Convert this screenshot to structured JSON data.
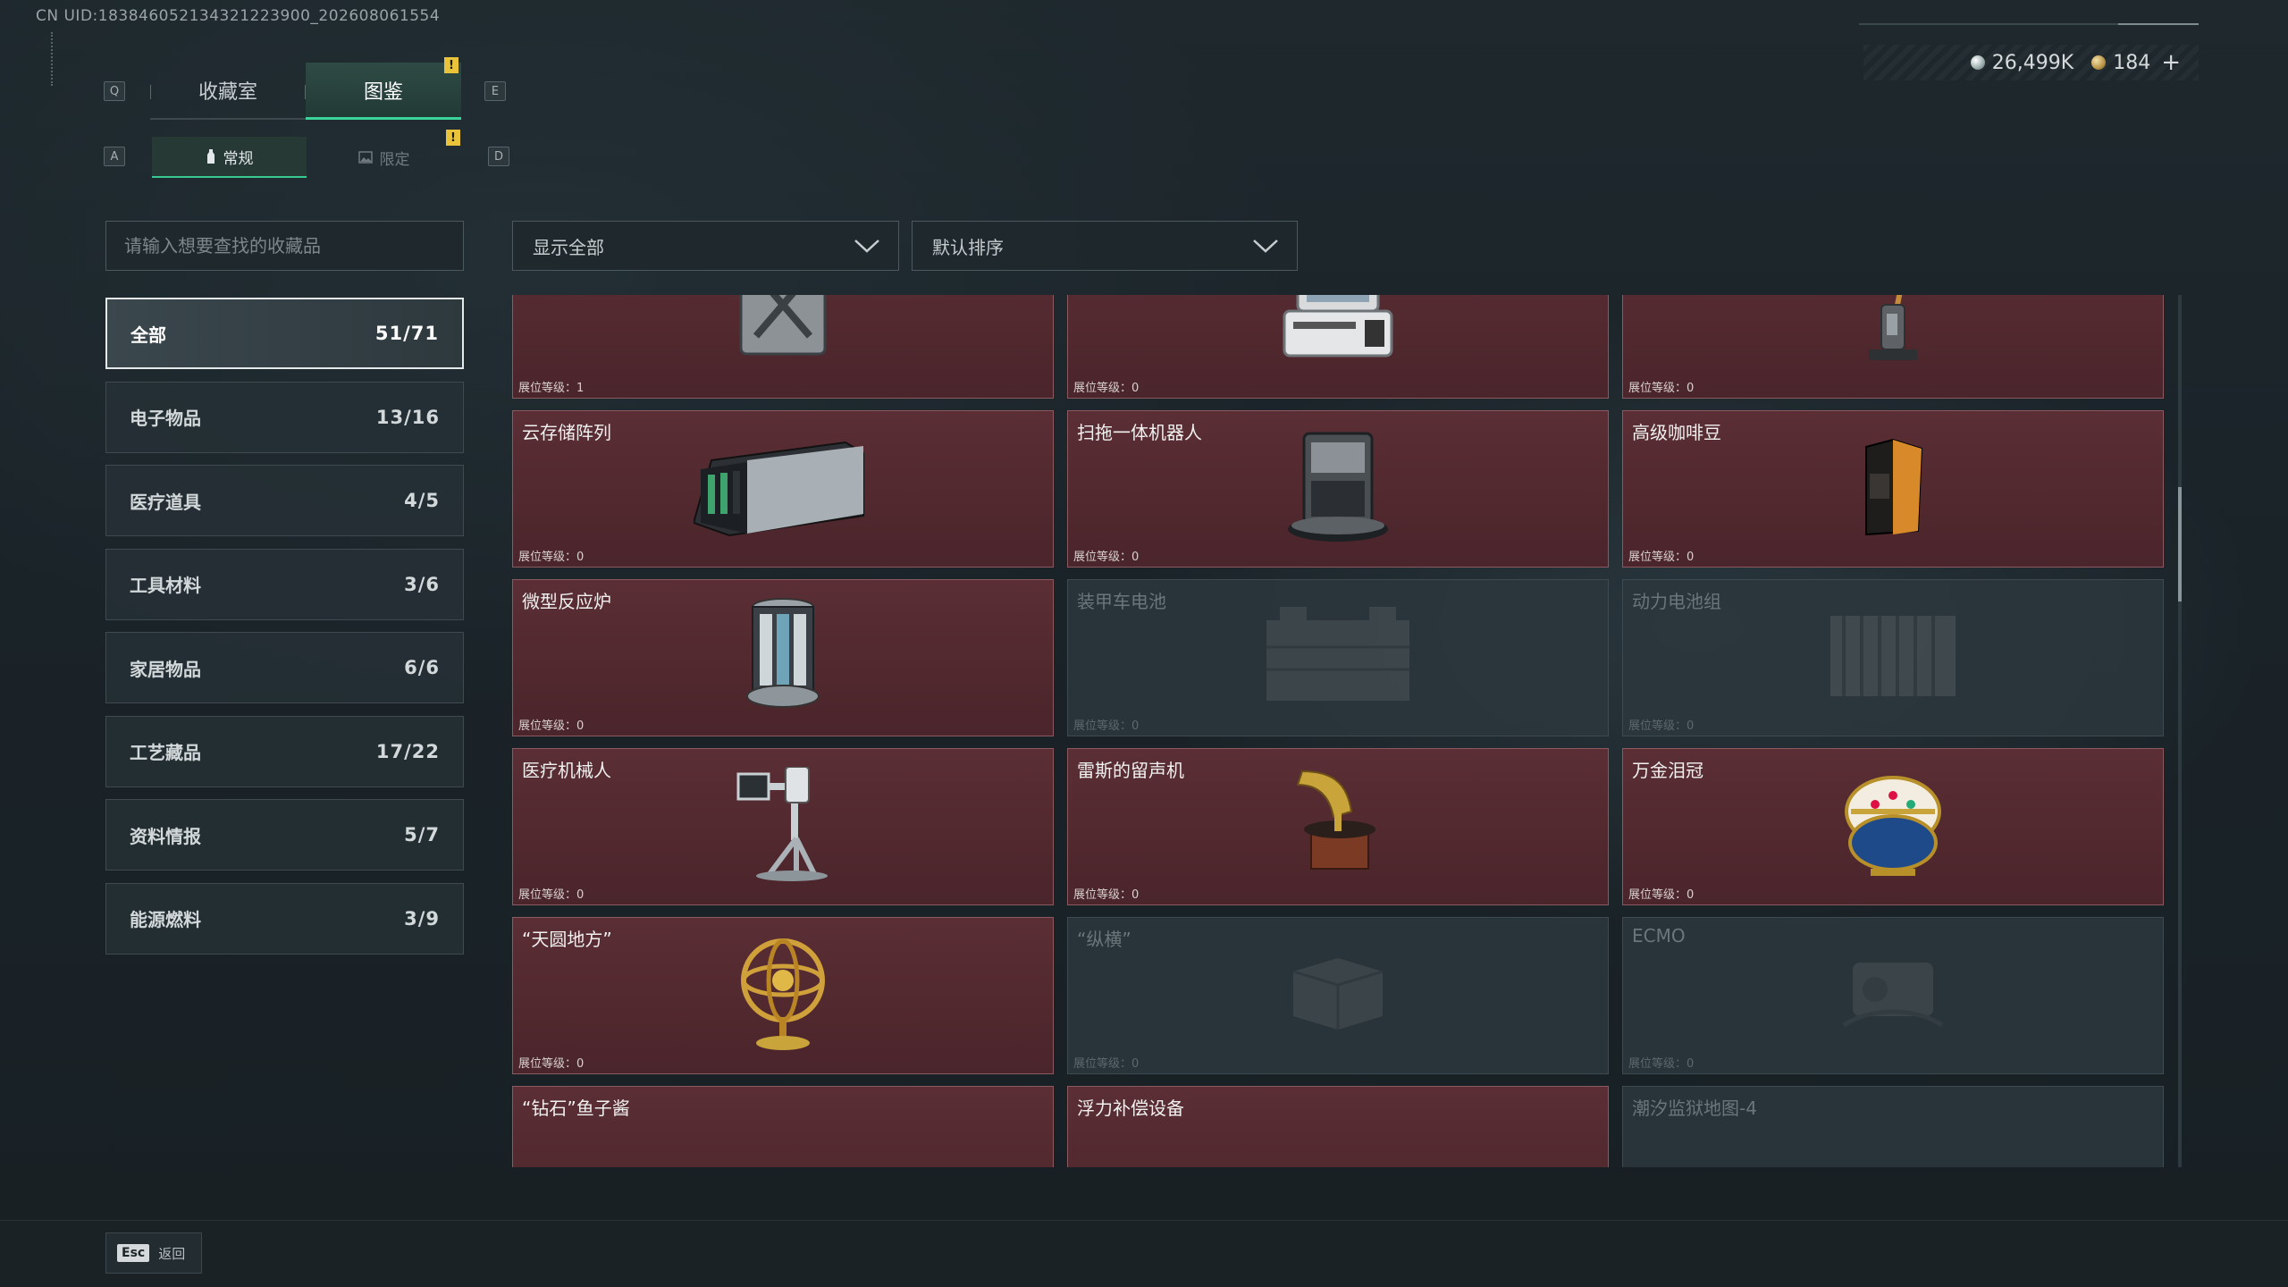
{
  "uid": "CN UID:18384605213432122390​0_202608061554",
  "currency": {
    "silver": "26,499K",
    "gold": "184",
    "plus": "+"
  },
  "keys": {
    "prev_tab": "Q",
    "next_tab": "E",
    "prev_sub": "A",
    "next_sub": "D"
  },
  "tabs": [
    {
      "label": "收藏室"
    },
    {
      "label": "图鉴"
    }
  ],
  "subtabs": [
    {
      "label": "常规"
    },
    {
      "label": "限定"
    }
  ],
  "badge": "!",
  "search": {
    "placeholder": "请输入想要查找的收藏品"
  },
  "filters": {
    "show": "显示全部",
    "sort": "默认排序"
  },
  "categories": [
    {
      "label": "全部",
      "count": "51/71"
    },
    {
      "label": "电子物品",
      "count": "13/16"
    },
    {
      "label": "医疗道具",
      "count": "4/5"
    },
    {
      "label": "工具材料",
      "count": "3/6"
    },
    {
      "label": "家居物品",
      "count": "6/6"
    },
    {
      "label": "工艺藏品",
      "count": "17/22"
    },
    {
      "label": "资料情报",
      "count": "5/7"
    },
    {
      "label": "能源燃料",
      "count": "3/9"
    }
  ],
  "items": [
    {
      "name": "",
      "level": "展位等级：1",
      "locked": false,
      "icon": "fuel-can-icon"
    },
    {
      "name": "",
      "level": "展位等级：0",
      "locked": false,
      "icon": "computer-terminal-icon"
    },
    {
      "name": "",
      "level": "展位等级：0",
      "locked": false,
      "icon": "floor-scrubber-icon"
    },
    {
      "name": "云存储阵列",
      "level": "展位等级：0",
      "locked": false,
      "icon": "storage-array-icon"
    },
    {
      "name": "扫拖一体机器人",
      "level": "展位等级：0",
      "locked": false,
      "icon": "robot-vacuum-icon"
    },
    {
      "name": "高级咖啡豆",
      "level": "展位等级：0",
      "locked": false,
      "icon": "coffee-bag-icon"
    },
    {
      "name": "微型反应炉",
      "level": "展位等级：0",
      "locked": false,
      "icon": "reactor-icon"
    },
    {
      "name": "装甲车电池",
      "level": "展位等级：0",
      "locked": true,
      "icon": "battery-icon"
    },
    {
      "name": "动力电池组",
      "level": "展位等级：0",
      "locked": true,
      "icon": "battery-pack-icon"
    },
    {
      "name": "医疗机械人",
      "level": "展位等级：0",
      "locked": false,
      "icon": "medical-robot-icon"
    },
    {
      "name": "雷斯的留声机",
      "level": "展位等级：0",
      "locked": false,
      "icon": "gramophone-icon"
    },
    {
      "name": "万金泪冠",
      "level": "展位等级：0",
      "locked": false,
      "icon": "jeweled-egg-icon"
    },
    {
      "name": "“天圆地方”",
      "level": "展位等级：0",
      "locked": false,
      "icon": "armillary-sphere-icon"
    },
    {
      "name": "“纵横”",
      "level": "展位等级：0",
      "locked": true,
      "icon": "box-icon"
    },
    {
      "name": "ECMO",
      "level": "展位等级：0",
      "locked": true,
      "icon": "ecmo-icon"
    },
    {
      "name": "“钻石”鱼子酱",
      "level": "",
      "locked": false,
      "icon": "caviar-tin-icon"
    },
    {
      "name": "浮力补偿设备",
      "level": "",
      "locked": false,
      "icon": "bcd-icon"
    },
    {
      "name": "潮汐监狱地图-4",
      "level": "",
      "locked": true,
      "icon": "map-icon"
    }
  ],
  "back": {
    "key": "Esc",
    "label": "返回"
  },
  "colors": {
    "accent": "#3bd39a",
    "card_unlocked": "#4e272d",
    "card_locked": "#2c373d",
    "badge": "#e9c43a"
  }
}
